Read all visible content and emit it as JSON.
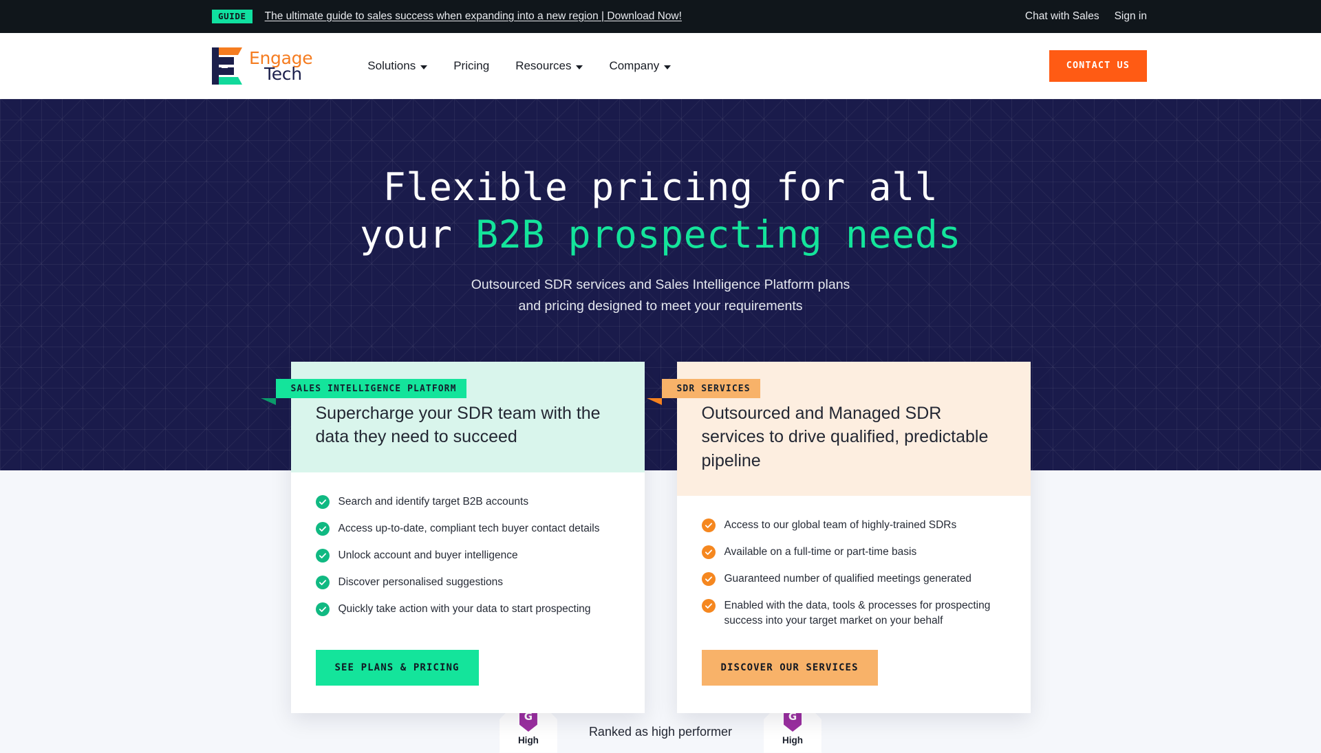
{
  "announcement": {
    "chip": "GUIDE",
    "link": "The ultimate guide to sales success when expanding into a new region | Download Now!",
    "chat": "Chat with Sales",
    "signin": "Sign in"
  },
  "brand": {
    "name_top": "Engage",
    "name_bottom": "Tech"
  },
  "nav": {
    "items": [
      {
        "label": "Solutions",
        "has_caret": true
      },
      {
        "label": "Pricing",
        "has_caret": false
      },
      {
        "label": "Resources",
        "has_caret": true
      },
      {
        "label": "Company",
        "has_caret": true
      }
    ],
    "cta": "CONTACT US"
  },
  "hero": {
    "title_line1": "Flexible pricing for all",
    "title_line2_plain": "your ",
    "title_line2_accent": "B2B prospecting needs",
    "sub_line1": "Outsourced SDR services and Sales Intelligence Platform plans",
    "sub_line2": "and pricing designed to meet your requirements"
  },
  "cards": [
    {
      "badge": "SALES INTELLIGENCE PLATFORM",
      "title": "Supercharge your SDR team with the data they need to succeed",
      "features": [
        "Search and identify target B2B accounts",
        "Access up-to-date, compliant tech buyer contact details",
        "Unlock account and buyer intelligence",
        "Discover personalised suggestions",
        "Quickly take action with your data to start prospecting"
      ],
      "cta": "SEE PLANS & PRICING"
    },
    {
      "badge": "SDR SERVICES",
      "title": "Outsourced and Managed SDR services to drive qualified, predictable pipeline",
      "features": [
        "Access to our global team of highly-trained SDRs",
        "Available on a full-time or part-time basis",
        "Guaranteed number of qualified meetings generated",
        "Enabled with the data, tools & processes for prospecting success into your target market on your behalf"
      ],
      "cta": "DISCOVER OUR SERVICES"
    }
  ],
  "g2": {
    "left_label": "High",
    "right_label": "High",
    "caption": "Ranked as high performer"
  },
  "colors": {
    "dark_navy": "#1a1b4b",
    "near_black": "#10161b",
    "green": "#14e49b",
    "orange": "#ff5b14",
    "peach": "#f8b269",
    "mint_panel": "#d9f5ec",
    "peach_panel": "#fdeee0",
    "page_bg": "#f5f7fb"
  }
}
